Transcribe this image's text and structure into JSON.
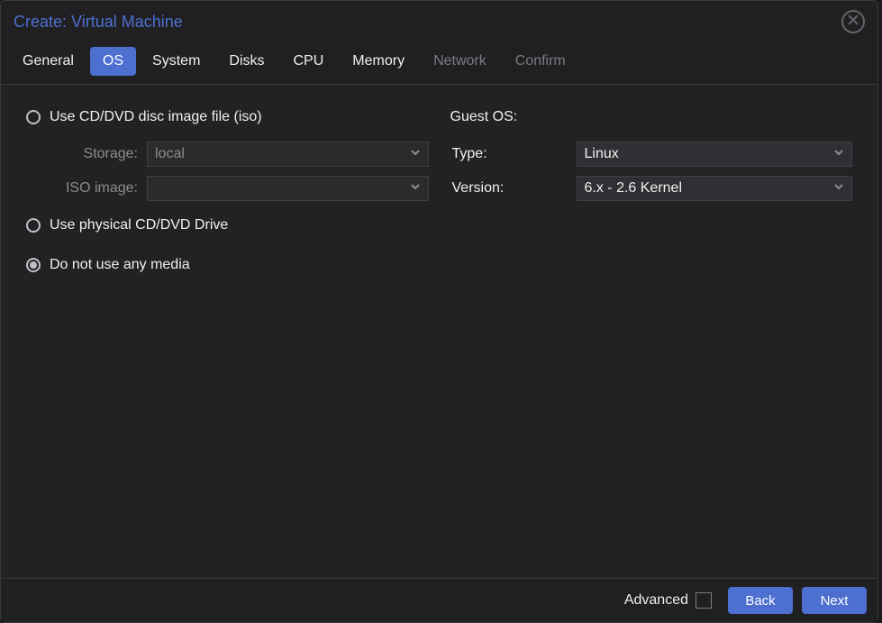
{
  "window": {
    "title": "Create: Virtual Machine"
  },
  "tabs": [
    {
      "label": "General",
      "state": "enabled"
    },
    {
      "label": "OS",
      "state": "active"
    },
    {
      "label": "System",
      "state": "enabled"
    },
    {
      "label": "Disks",
      "state": "enabled"
    },
    {
      "label": "CPU",
      "state": "enabled"
    },
    {
      "label": "Memory",
      "state": "enabled"
    },
    {
      "label": "Network",
      "state": "disabled"
    },
    {
      "label": "Confirm",
      "state": "disabled"
    }
  ],
  "media": {
    "options": {
      "iso": {
        "label": "Use CD/DVD disc image file (iso)",
        "selected": false
      },
      "drive": {
        "label": "Use physical CD/DVD Drive",
        "selected": false
      },
      "none": {
        "label": "Do not use any media",
        "selected": true
      }
    },
    "storage_label": "Storage:",
    "storage_value": "local",
    "iso_image_label": "ISO image:",
    "iso_image_value": ""
  },
  "guest_os": {
    "section_label": "Guest OS:",
    "type_label": "Type:",
    "type_value": "Linux",
    "version_label": "Version:",
    "version_value": "6.x - 2.6 Kernel"
  },
  "footer": {
    "advanced_label": "Advanced",
    "advanced_checked": false,
    "back_label": "Back",
    "next_label": "Next"
  }
}
